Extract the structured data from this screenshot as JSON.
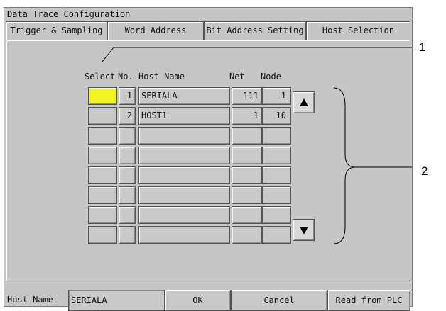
{
  "window": {
    "title": "Data Trace Configuration"
  },
  "tabs": [
    {
      "label": "Trigger & Sampling"
    },
    {
      "label": "Word Address"
    },
    {
      "label": "Bit Address Setting"
    },
    {
      "label": "Host Selection",
      "active": true
    }
  ],
  "table": {
    "headers": {
      "select": "Select",
      "no": "No.",
      "name": "Host Name",
      "net": "Net",
      "node": "Node"
    },
    "rows": [
      {
        "selected": true,
        "no": "1",
        "name": "SERIALA",
        "net": "111",
        "node": "1"
      },
      {
        "selected": false,
        "no": "2",
        "name": "HOST1",
        "net": "1",
        "node": "10"
      },
      {
        "selected": false,
        "no": "",
        "name": "",
        "net": "",
        "node": ""
      },
      {
        "selected": false,
        "no": "",
        "name": "",
        "net": "",
        "node": ""
      },
      {
        "selected": false,
        "no": "",
        "name": "",
        "net": "",
        "node": ""
      },
      {
        "selected": false,
        "no": "",
        "name": "",
        "net": "",
        "node": ""
      },
      {
        "selected": false,
        "no": "",
        "name": "",
        "net": "",
        "node": ""
      },
      {
        "selected": false,
        "no": "",
        "name": "",
        "net": "",
        "node": ""
      }
    ]
  },
  "scroll": {
    "up_icon": "triangle-up-icon",
    "down_icon": "triangle-down-icon"
  },
  "footer": {
    "host_name_label": "Host Name",
    "host_name_value": "SERIALA",
    "ok_label": "OK",
    "cancel_label": "Cancel",
    "read_label": "Read from PLC"
  },
  "callouts": {
    "one": "1",
    "two": "2"
  },
  "colors": {
    "background": "#c6c6c6",
    "selected": "#f2f21c"
  }
}
